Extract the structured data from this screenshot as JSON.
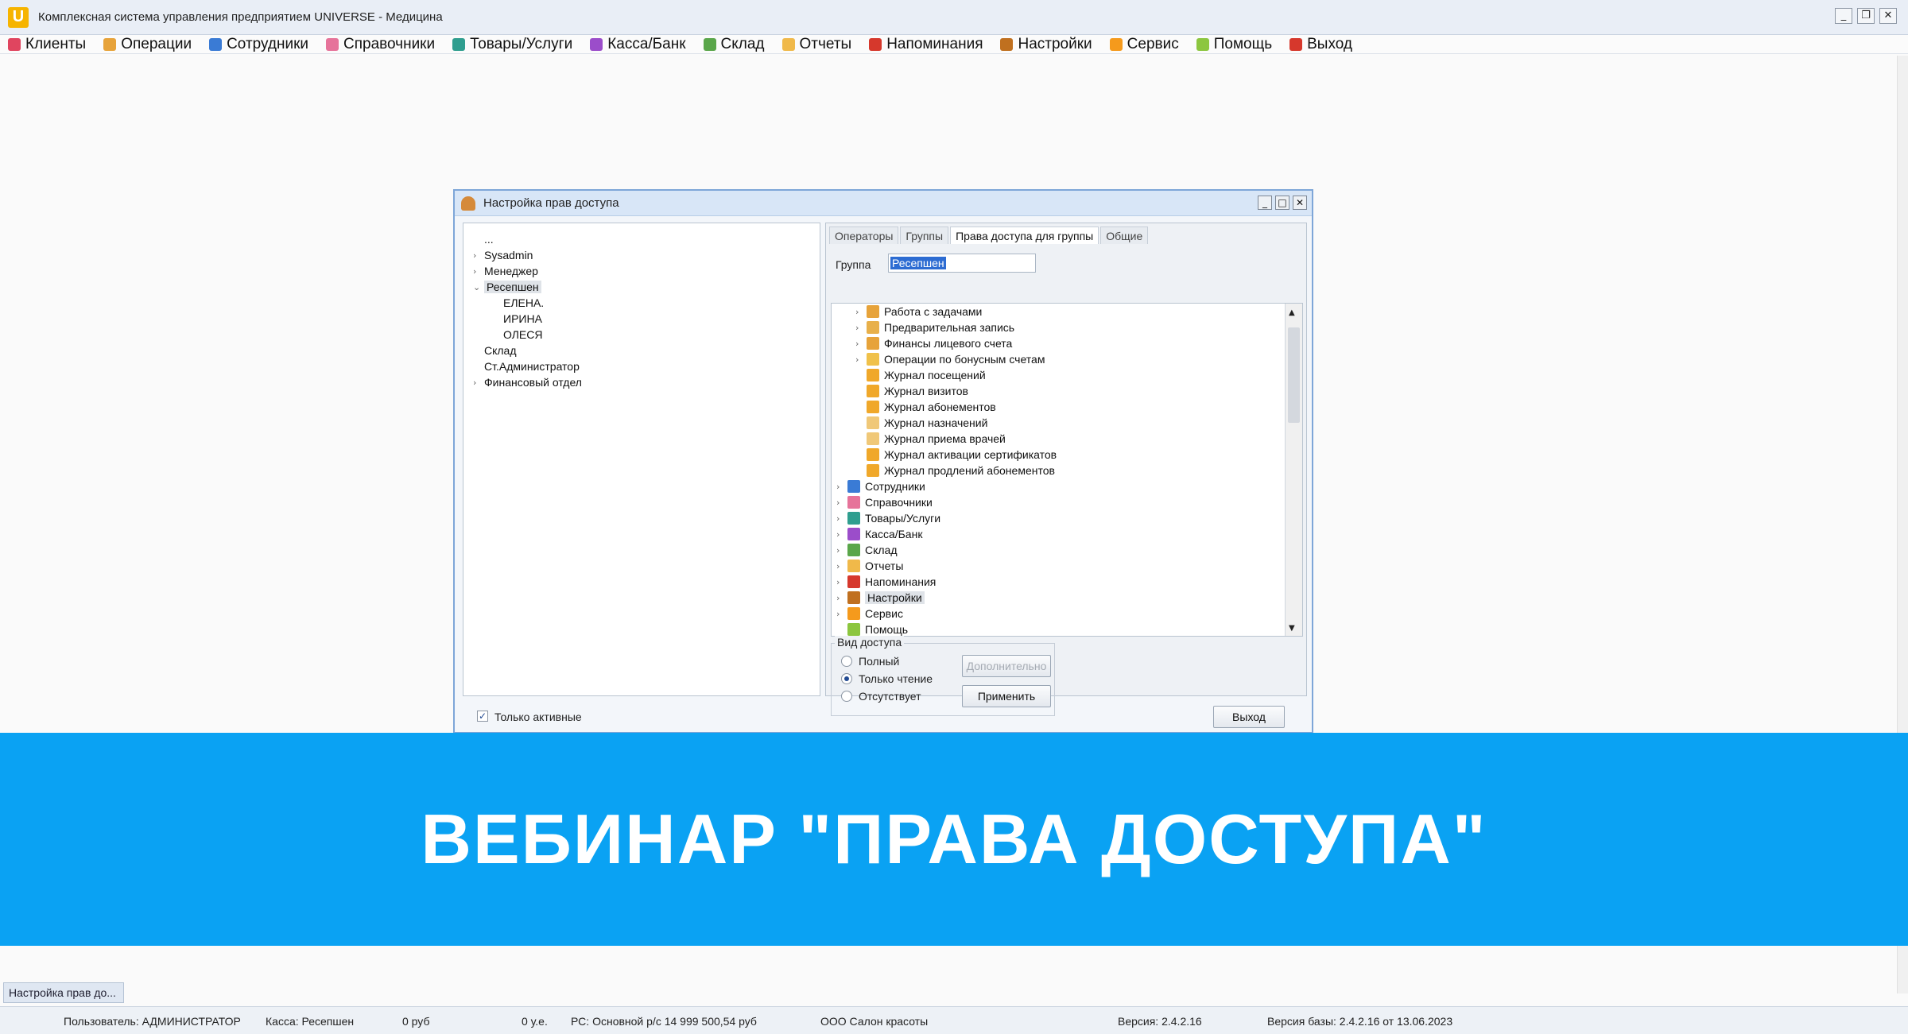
{
  "app": {
    "logo_letter": "U",
    "title": "Комплексная система управления предприятием UNIVERSE - Медицина",
    "controls": [
      "_",
      "❐",
      "✕"
    ]
  },
  "menu": [
    {
      "label": "Клиенты",
      "color": "#e0455f"
    },
    {
      "label": "Операции",
      "color": "#e7a33a"
    },
    {
      "label": "Сотрудники",
      "color": "#3a7bd5"
    },
    {
      "label": "Справочники",
      "color": "#e6739a"
    },
    {
      "label": "Товары/Услуги",
      "color": "#2f9e8f"
    },
    {
      "label": "Касса/Банк",
      "color": "#9b4dca"
    },
    {
      "label": "Склад",
      "color": "#5aa64a"
    },
    {
      "label": "Отчеты",
      "color": "#f0b94a"
    },
    {
      "label": "Напоминания",
      "color": "#d6382c"
    },
    {
      "label": "Настройки",
      "color": "#c0701f"
    },
    {
      "label": "Сервис",
      "color": "#f59a1c"
    },
    {
      "label": "Помощь",
      "color": "#8cc63f"
    },
    {
      "label": "Выход",
      "color": "#d6382c"
    }
  ],
  "dialog": {
    "title": "Настройка прав доступа",
    "controls": [
      "_",
      "□",
      "✕"
    ],
    "left_tree": [
      {
        "label": "...",
        "level": 0,
        "expander": ""
      },
      {
        "label": "Sysadmin",
        "level": 0,
        "expander": "›"
      },
      {
        "label": "Менеджер",
        "level": 0,
        "expander": "›"
      },
      {
        "label": "Ресепшен",
        "level": 0,
        "expander": "⌄",
        "selected": true
      },
      {
        "label": "ЕЛЕНА.",
        "level": 1,
        "expander": ""
      },
      {
        "label": "ИРИНА",
        "level": 1,
        "expander": ""
      },
      {
        "label": "ОЛЕСЯ",
        "level": 1,
        "expander": ""
      },
      {
        "label": "Склад",
        "level": 0,
        "expander": ""
      },
      {
        "label": "Ст.Администратор",
        "level": 0,
        "expander": ""
      },
      {
        "label": "Финансовый отдел",
        "level": 0,
        "expander": "›"
      }
    ],
    "tabs": [
      {
        "label": "Операторы",
        "active": false
      },
      {
        "label": "Группы",
        "active": false
      },
      {
        "label": "Права доступа для группы",
        "active": true
      },
      {
        "label": "Общие",
        "active": false
      }
    ],
    "group_label": "Группа",
    "group_value": "Ресепшен",
    "perm_tree": [
      {
        "label": "Работа с задачами",
        "level": 1,
        "expander": "›",
        "color": "#e7a33a"
      },
      {
        "label": "Предварительная запись",
        "level": 1,
        "expander": "›",
        "color": "#e8b04a"
      },
      {
        "label": "Финансы лицевого счета",
        "level": 1,
        "expander": "›",
        "color": "#e7a33a"
      },
      {
        "label": "Операции по бонусным счетам",
        "level": 1,
        "expander": "›",
        "color": "#f0c14a"
      },
      {
        "label": "Журнал посещений",
        "level": 1,
        "expander": "",
        "color": "#f0a82a"
      },
      {
        "label": "Журнал визитов",
        "level": 1,
        "expander": "",
        "color": "#f0a82a"
      },
      {
        "label": "Журнал абонементов",
        "level": 1,
        "expander": "",
        "color": "#f0a82a"
      },
      {
        "label": "Журнал назначений",
        "level": 1,
        "expander": "",
        "color": "#f0c878"
      },
      {
        "label": "Журнал приема врачей",
        "level": 1,
        "expander": "",
        "color": "#f0c878"
      },
      {
        "label": "Журнал активации сертификатов",
        "level": 1,
        "expander": "",
        "color": "#f0a82a"
      },
      {
        "label": "Журнал продлений абонементов",
        "level": 1,
        "expander": "",
        "color": "#f0a82a"
      },
      {
        "label": "Сотрудники",
        "level": 0,
        "expander": "›",
        "color": "#3a7bd5"
      },
      {
        "label": "Справочники",
        "level": 0,
        "expander": "›",
        "color": "#e6739a"
      },
      {
        "label": "Товары/Услуги",
        "level": 0,
        "expander": "›",
        "color": "#2f9e8f"
      },
      {
        "label": "Касса/Банк",
        "level": 0,
        "expander": "›",
        "color": "#9b4dca"
      },
      {
        "label": "Склад",
        "level": 0,
        "expander": "›",
        "color": "#5aa64a"
      },
      {
        "label": "Отчеты",
        "level": 0,
        "expander": "›",
        "color": "#f0b94a"
      },
      {
        "label": "Напоминания",
        "level": 0,
        "expander": "›",
        "color": "#d6382c"
      },
      {
        "label": "Настройки",
        "level": 0,
        "expander": "›",
        "color": "#c0701f",
        "selected": true
      },
      {
        "label": "Сервис",
        "level": 0,
        "expander": "›",
        "color": "#f59a1c"
      },
      {
        "label": "Помощь",
        "level": 0,
        "expander": "",
        "color": "#8cc63f"
      }
    ],
    "access": {
      "title": "Вид доступа",
      "options": [
        {
          "label": "Полный",
          "checked": false
        },
        {
          "label": "Только чтение",
          "checked": true
        },
        {
          "label": "Отсутствует",
          "checked": false
        }
      ],
      "more_button": "Дополнительно",
      "apply_button": "Применить"
    },
    "only_active_label": "Только активные",
    "only_active_checked": "✓",
    "exit_button": "Выход"
  },
  "banner_text": "ВЕБИНАР \"ПРАВА ДОСТУПА\"",
  "minimized_window": "Настройка прав до...",
  "status": {
    "user": "Пользователь: АДМИНИСТРАТОР",
    "cashbox": "Касса: Ресепшен",
    "rub": "0 руб",
    "ue": "0 у.е.",
    "account": "РС: Основной р/с 14 999 500,54 руб",
    "org": "ООО Салон красоты",
    "version": "Версия: 2.4.2.16",
    "db_version": "Версия базы: 2.4.2.16 от 13.06.2023"
  }
}
